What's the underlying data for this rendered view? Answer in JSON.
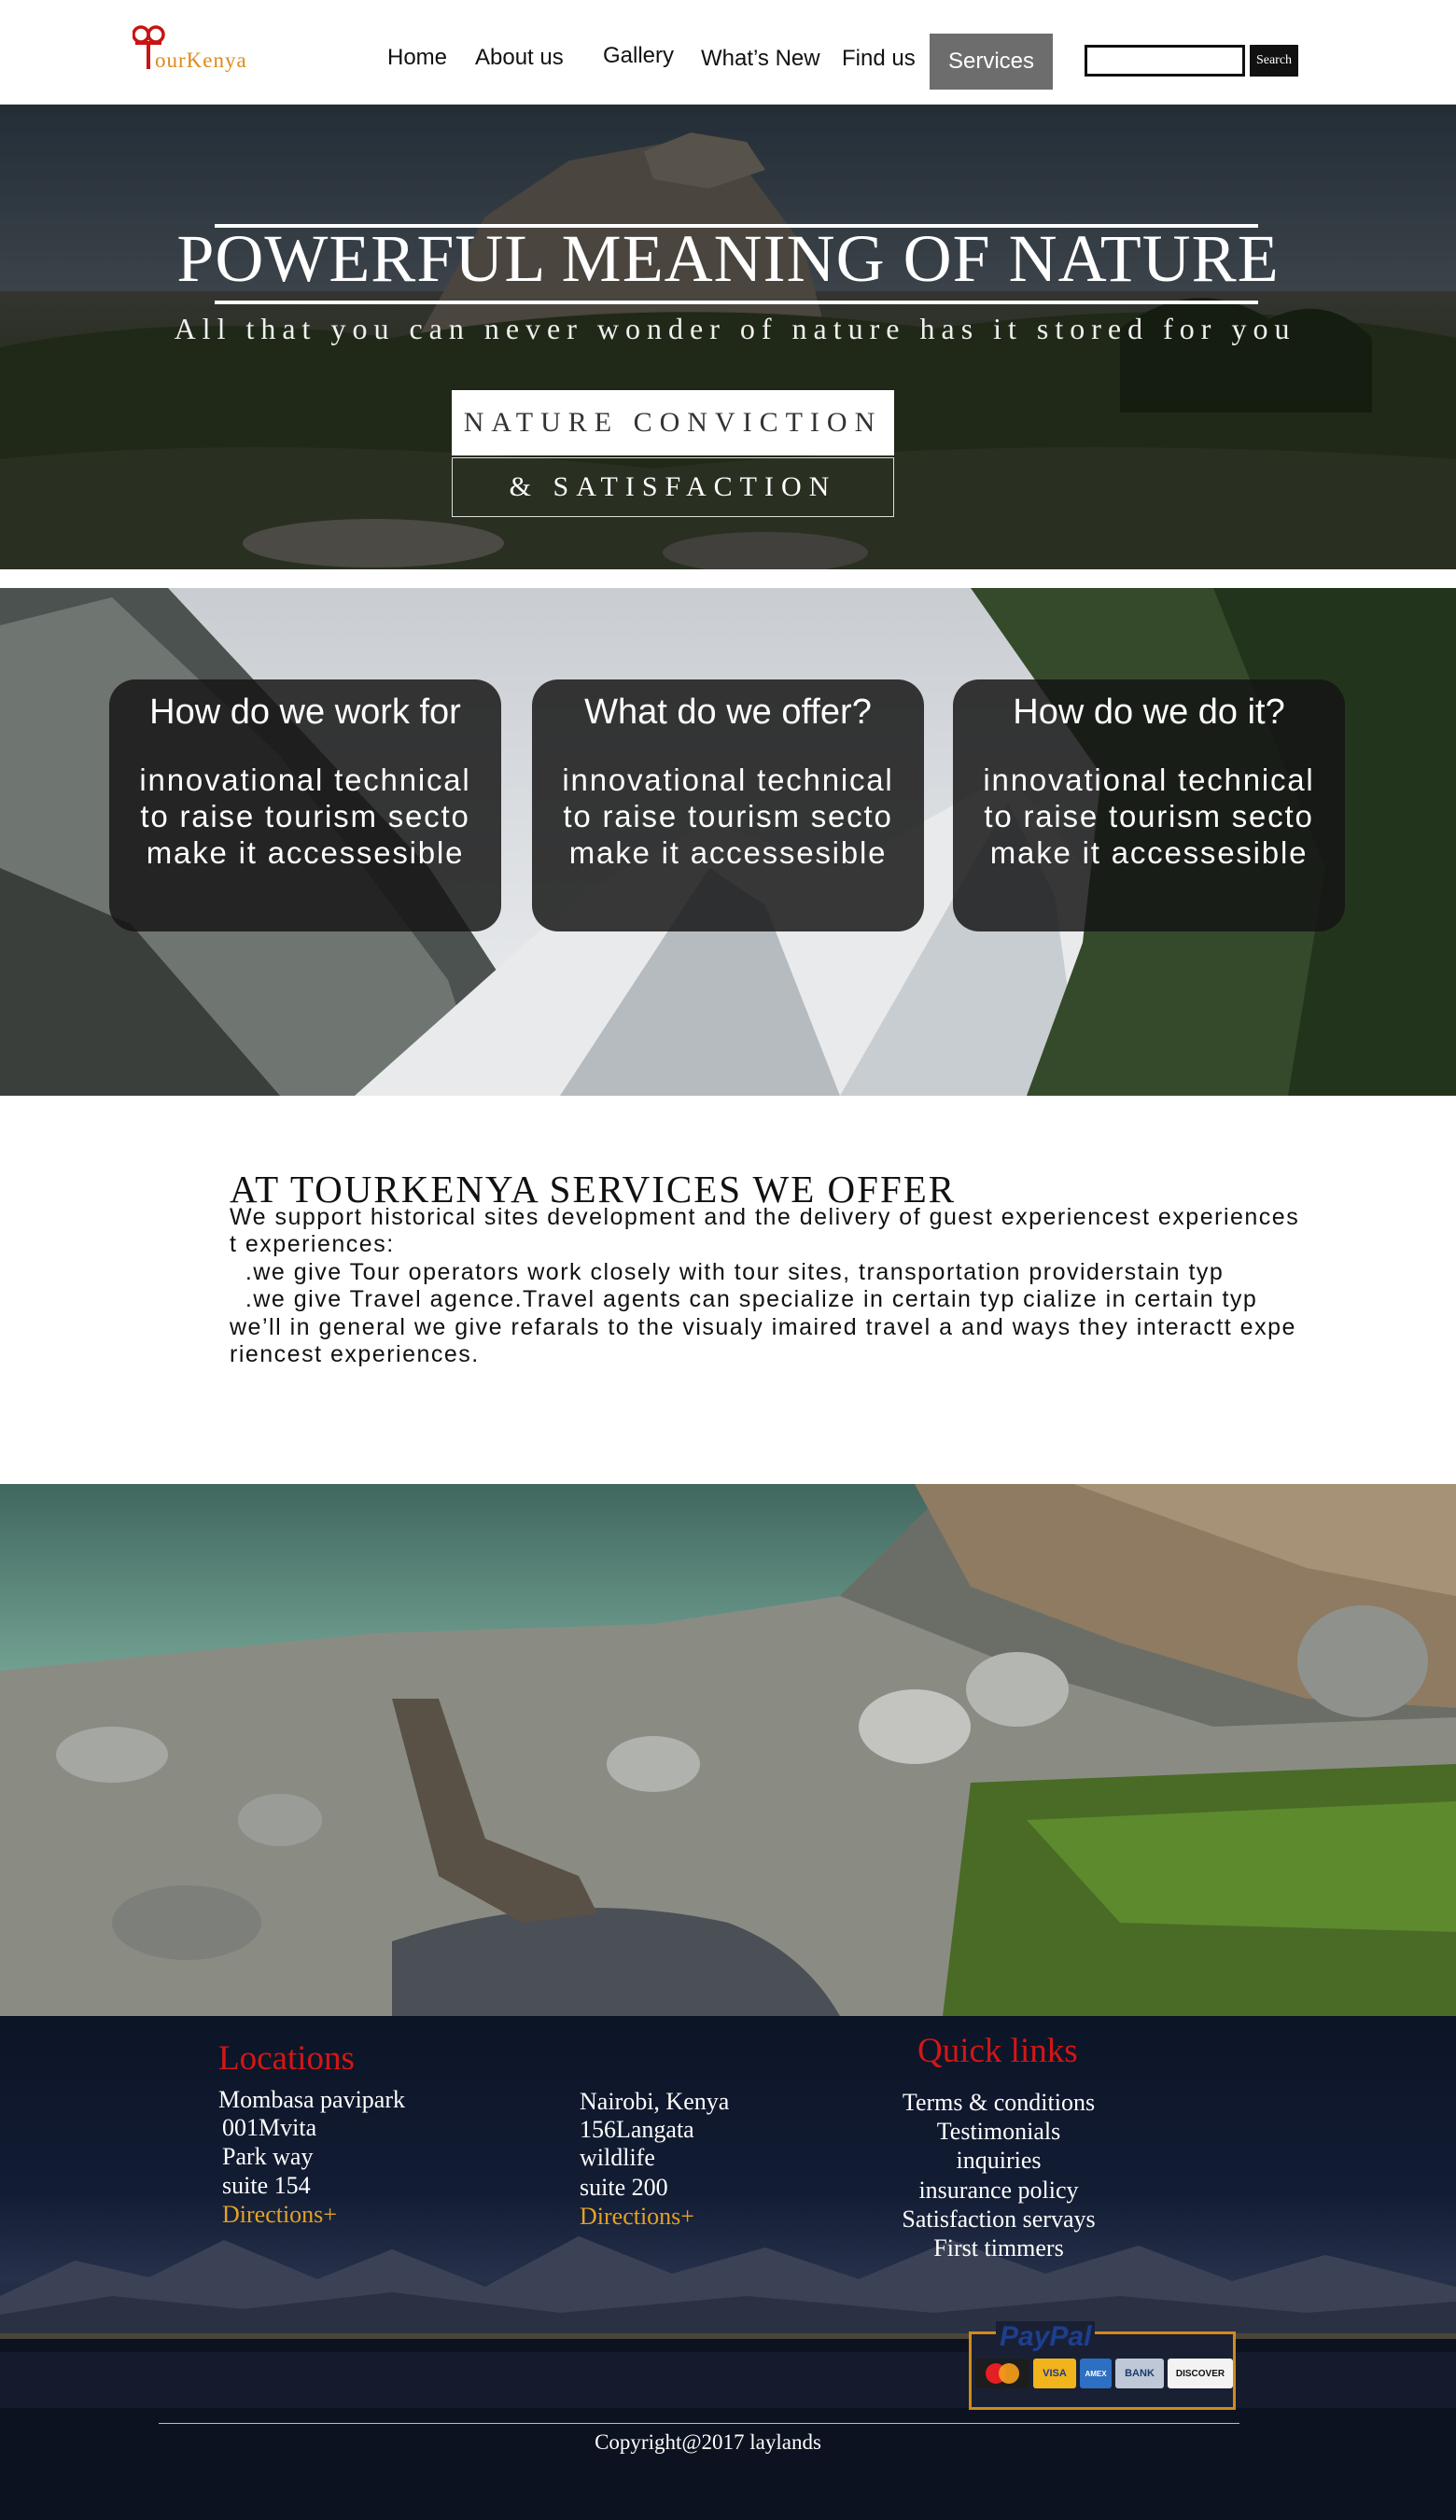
{
  "brand": {
    "logo_text": "ourKenya",
    "accent_color": "#e08a18",
    "logo_color": "#c81414"
  },
  "nav": {
    "items": [
      "Home",
      "About us",
      "Gallery",
      "What’s New",
      "Find us"
    ],
    "active": "Services"
  },
  "search": {
    "placeholder": "",
    "button": "Search"
  },
  "hero": {
    "title": "POWERFUL MEANING OF NATURE",
    "subtitle": "All that you can never wonder of nature has it stored for you",
    "button_primary": "NATURE CONVICTION",
    "button_secondary": "& SATISFACTION"
  },
  "cards": [
    {
      "title": "How do we work for",
      "body": "innovational technical\nto raise tourism secto\nmake it accessesible"
    },
    {
      "title": "What do we offer?",
      "body": "innovational technical\nto raise tourism secto\nmake it accessesible"
    },
    {
      "title": "How do we do it?",
      "body": "innovational technical\nto raise tourism secto\nmake it accessesible"
    }
  ],
  "services": {
    "heading": "AT TOURKENYA SERVICES WE OFFER",
    "text": "We support historical sites development and the delivery of guest experiencest experiences\nt experiences:\n  .we give Tour operators work closely with tour sites, transportation providerstain typ\n  .we give Travel agence.Travel agents can specialize in certain typ cialize in certain typ\nwe’ll in general we give refarals to the visualy imaired travel a and ways they interactt expe\nriencest experiences."
  },
  "footer": {
    "locations_heading": "Locations",
    "location_1": {
      "lines": [
        "Mombasa pavipark",
        "001Mvita",
        "Park way",
        "suite 154"
      ],
      "directions": "Directions+"
    },
    "location_2": {
      "lines": [
        "Nairobi, Kenya",
        "156Langata",
        "wildlife",
        "suite 200"
      ],
      "directions": "Directions+"
    },
    "quick_links_heading": "Quick links",
    "quick_links": [
      "Terms & conditions",
      "Testimonials",
      "inquiries",
      "insurance policy",
      "Satisfaction servays",
      "First timmers"
    ],
    "payment": {
      "brand": "PayPal",
      "cards": [
        "MasterCard",
        "VISA",
        "AMEX",
        "BANK",
        "DISCOVER"
      ]
    },
    "copyright": "Copyright@2017 laylands"
  }
}
